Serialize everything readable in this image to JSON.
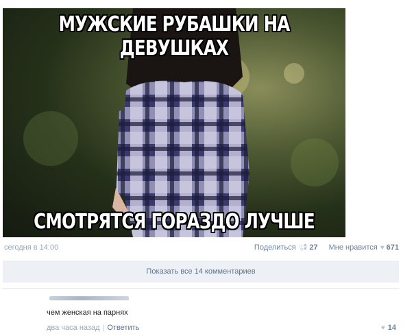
{
  "post": {
    "image": {
      "top_caption": "МУЖСКИЕ РУБАШКИ НА ДЕВУШКАХ",
      "bottom_caption": "СМОТРЯТСЯ ГОРАЗДО ЛУЧШЕ"
    },
    "date": "сегодня в 14:00",
    "share_label": "Поделиться",
    "share_count": "27",
    "like_label": "Мне нравится",
    "like_count": "671",
    "share_icon": "megaphone-icon",
    "like_icon": "heart-icon"
  },
  "comments": {
    "show_all_label": "Показать все 14 комментариев",
    "items": [
      {
        "text": "чем женская на парнях",
        "time": "два часа назад",
        "reply_label": "Ответить",
        "likes": "14"
      }
    ]
  },
  "colors": {
    "link": "#5b7391",
    "muted": "#9aa5b3",
    "panel": "#edf1f5"
  }
}
